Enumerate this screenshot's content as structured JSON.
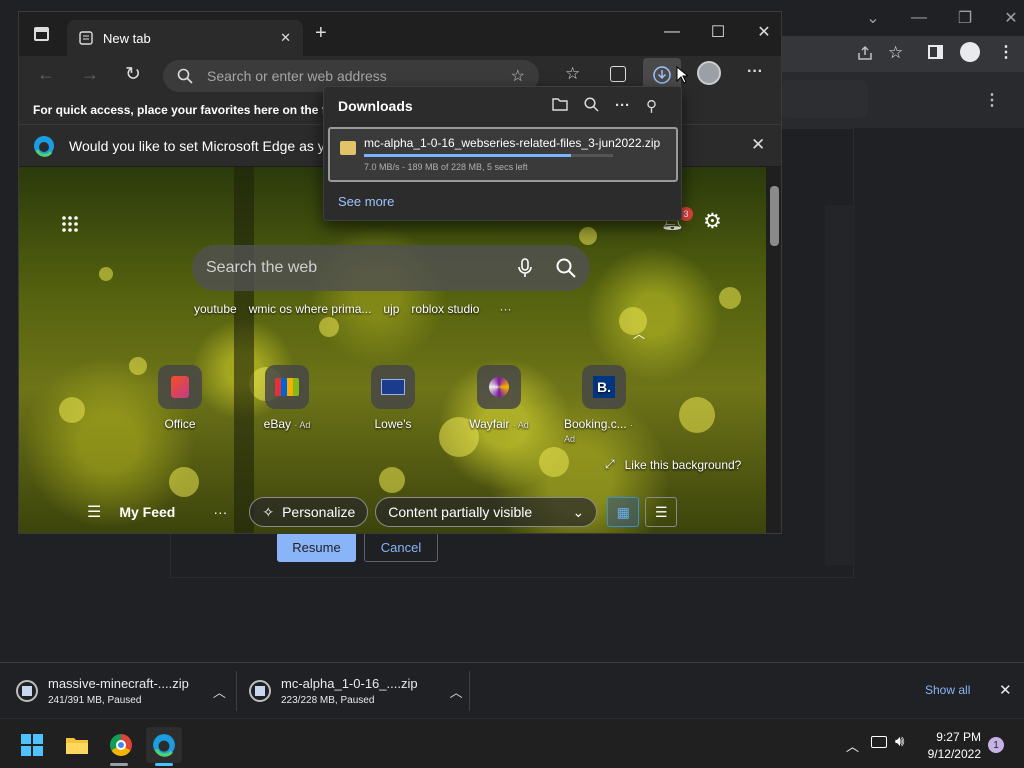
{
  "edge": {
    "tab_title": "New tab",
    "address_placeholder": "Search or enter web address",
    "favorites_bar_text": "For quick access, place your favorites here on the favo",
    "infobar_text": "Would you like to set Microsoft Edge as you",
    "newtab": {
      "search_placeholder": "Search the web",
      "quick_links": [
        "youtube",
        "wmic os where prima...",
        "ujp",
        "roblox studio",
        "···"
      ],
      "sites": [
        {
          "name": "Office",
          "ad": ""
        },
        {
          "name": "eBay",
          "ad": "· Ad"
        },
        {
          "name": "Lowe's",
          "ad": ""
        },
        {
          "name": "Wayfair",
          "ad": "· Ad"
        },
        {
          "name": "Booking.c...",
          "ad": "· Ad"
        }
      ],
      "notification_count": "3",
      "like_background": "Like this background?",
      "feed_label": "My Feed",
      "more": "···",
      "personalize": "Personalize",
      "content_visibility": "Content partially visible"
    }
  },
  "downloads_flyout": {
    "title": "Downloads",
    "item": {
      "filename": "mc-alpha_1-0-16_webseries-related-files_3-jun2022.zip",
      "status": "7.0 MB/s - 189 MB of 228 MB, 5 secs left",
      "progress": 0.83
    },
    "see_more": "See more"
  },
  "underlying_page": {
    "resume_label": "Resume",
    "cancel_label": "Cancel"
  },
  "chrome_shelf": {
    "items": [
      {
        "name": "massive-minecraft-....zip",
        "status": "241/391 MB, Paused"
      },
      {
        "name": "mc-alpha_1-0-16_....zip",
        "status": "223/228 MB, Paused"
      }
    ],
    "show_all": "Show all"
  },
  "taskbar": {
    "time": "9:27 PM",
    "date": "9/12/2022",
    "notification_count": "1"
  },
  "colors": {
    "accent": "#8ab4f8",
    "progress": "#7ab4ff"
  },
  "icons": [
    "tab-actions-icon",
    "page-icon",
    "close-icon",
    "plus-icon",
    "back-icon",
    "forward-icon",
    "refresh-icon",
    "search-icon",
    "add-favorite-icon",
    "favorites-icon",
    "collections-icon",
    "download-icon",
    "profile-icon",
    "more-icon",
    "edge-logo-icon",
    "folder-icon",
    "pin-icon",
    "zip-file-icon",
    "apps-grid-icon",
    "bell-icon",
    "gear-icon",
    "mic-icon",
    "hamburger-icon",
    "sparkle-icon",
    "chevron-down-icon",
    "grid-view-icon",
    "list-view-icon",
    "expand-icon",
    "chevron-up-icon",
    "windows-start-icon",
    "file-explorer-icon",
    "chrome-icon",
    "edge-icon",
    "wifi-icon",
    "volume-icon",
    "monitor-icon",
    "share-icon",
    "star-icon",
    "sidebar-icon"
  ]
}
